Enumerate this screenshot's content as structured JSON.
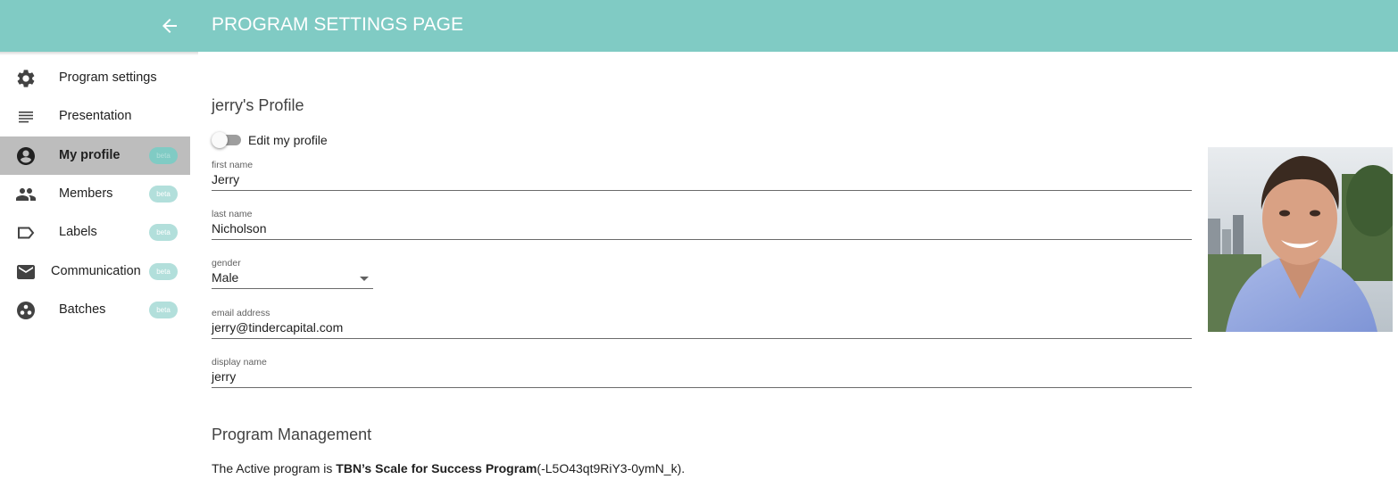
{
  "header": {
    "title": "PROGRAM SETTINGS PAGE",
    "accent_color": "#80cbc4",
    "back_icon": "arrow-left-icon"
  },
  "sidebar": {
    "items": [
      {
        "label": "Program settings",
        "icon": "gear-icon",
        "badge": "",
        "active": false
      },
      {
        "label": "Presentation",
        "icon": "notes-lines-icon",
        "badge": "",
        "active": false
      },
      {
        "label": "My profile",
        "icon": "account-circle-icon",
        "badge": "beta",
        "active": true
      },
      {
        "label": "Members",
        "icon": "people-icon",
        "badge": "beta",
        "active": false
      },
      {
        "label": "Labels",
        "icon": "label-tag-icon",
        "badge": "beta",
        "active": false
      },
      {
        "label": "Communication",
        "icon": "mail-icon",
        "badge": "beta",
        "active": false
      },
      {
        "label": "Batches",
        "icon": "group-circle-icon",
        "badge": "beta",
        "active": false
      }
    ]
  },
  "profile": {
    "title": "jerry's Profile",
    "edit_toggle_label": "Edit my profile",
    "edit_enabled": false,
    "fields": {
      "first_name": {
        "label": "first name",
        "value": "Jerry"
      },
      "last_name": {
        "label": "last name",
        "value": "Nicholson"
      },
      "gender": {
        "label": "gender",
        "value": "Male"
      },
      "email": {
        "label": "email address",
        "value": "jerry@tindercapital.com"
      },
      "display_name": {
        "label": "display name",
        "value": "jerry"
      }
    },
    "avatar": "profile-photo"
  },
  "program": {
    "title": "Program Management",
    "prefix": "The Active program is ",
    "name": "TBN’s Scale for Success Program",
    "id_text": "(-L5O43qt9RiY3-0ymN_k)."
  }
}
